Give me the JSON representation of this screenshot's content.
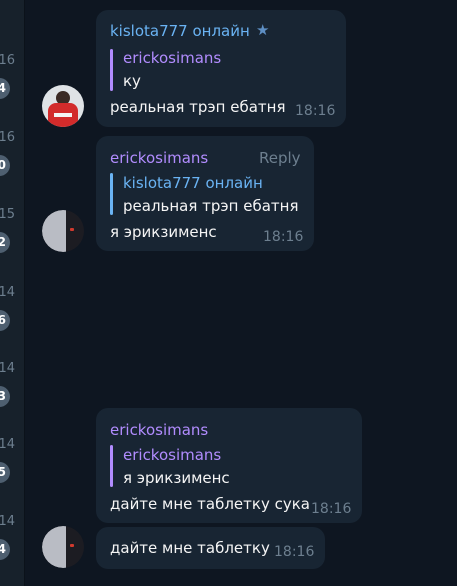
{
  "sidebar": {
    "entries": [
      {
        "time": "16",
        "badge": "4"
      },
      {
        "time": "16",
        "badge": "0"
      },
      {
        "time": "15",
        "badge": "2"
      },
      {
        "time": "14",
        "badge": "6"
      },
      {
        "time": "14",
        "badge": "3"
      },
      {
        "time": "14",
        "badge": "5"
      },
      {
        "time": "14",
        "badge": "4"
      }
    ]
  },
  "messages": [
    {
      "sender": "kislota777 онлайн",
      "sender_status_icon": "star-icon",
      "reply": {
        "name": "erickosimans",
        "text": "ку"
      },
      "text": "реальная трэп ебатня",
      "time": "18:16"
    },
    {
      "sender": "erickosimans",
      "reply_action": "Reply",
      "reply": {
        "name": "kislota777 онлайн",
        "text": "реальная трэп ебатня"
      },
      "text": "я эрикзименс",
      "time": "18:16"
    },
    {
      "sender": "erickosimans",
      "reply": {
        "name": "erickosimans",
        "text": "я эрикзименс"
      },
      "text": "дайте мне таблетку сука",
      "time": "18:16"
    },
    {
      "text": "дайте мне таблетку",
      "time": "18:16"
    }
  ],
  "colors": {
    "background": "#0e1621",
    "bubble": "#182533",
    "sender_blue": "#6ab3f3",
    "sender_purple": "#b18cfe",
    "meta": "#6d7f8f"
  }
}
